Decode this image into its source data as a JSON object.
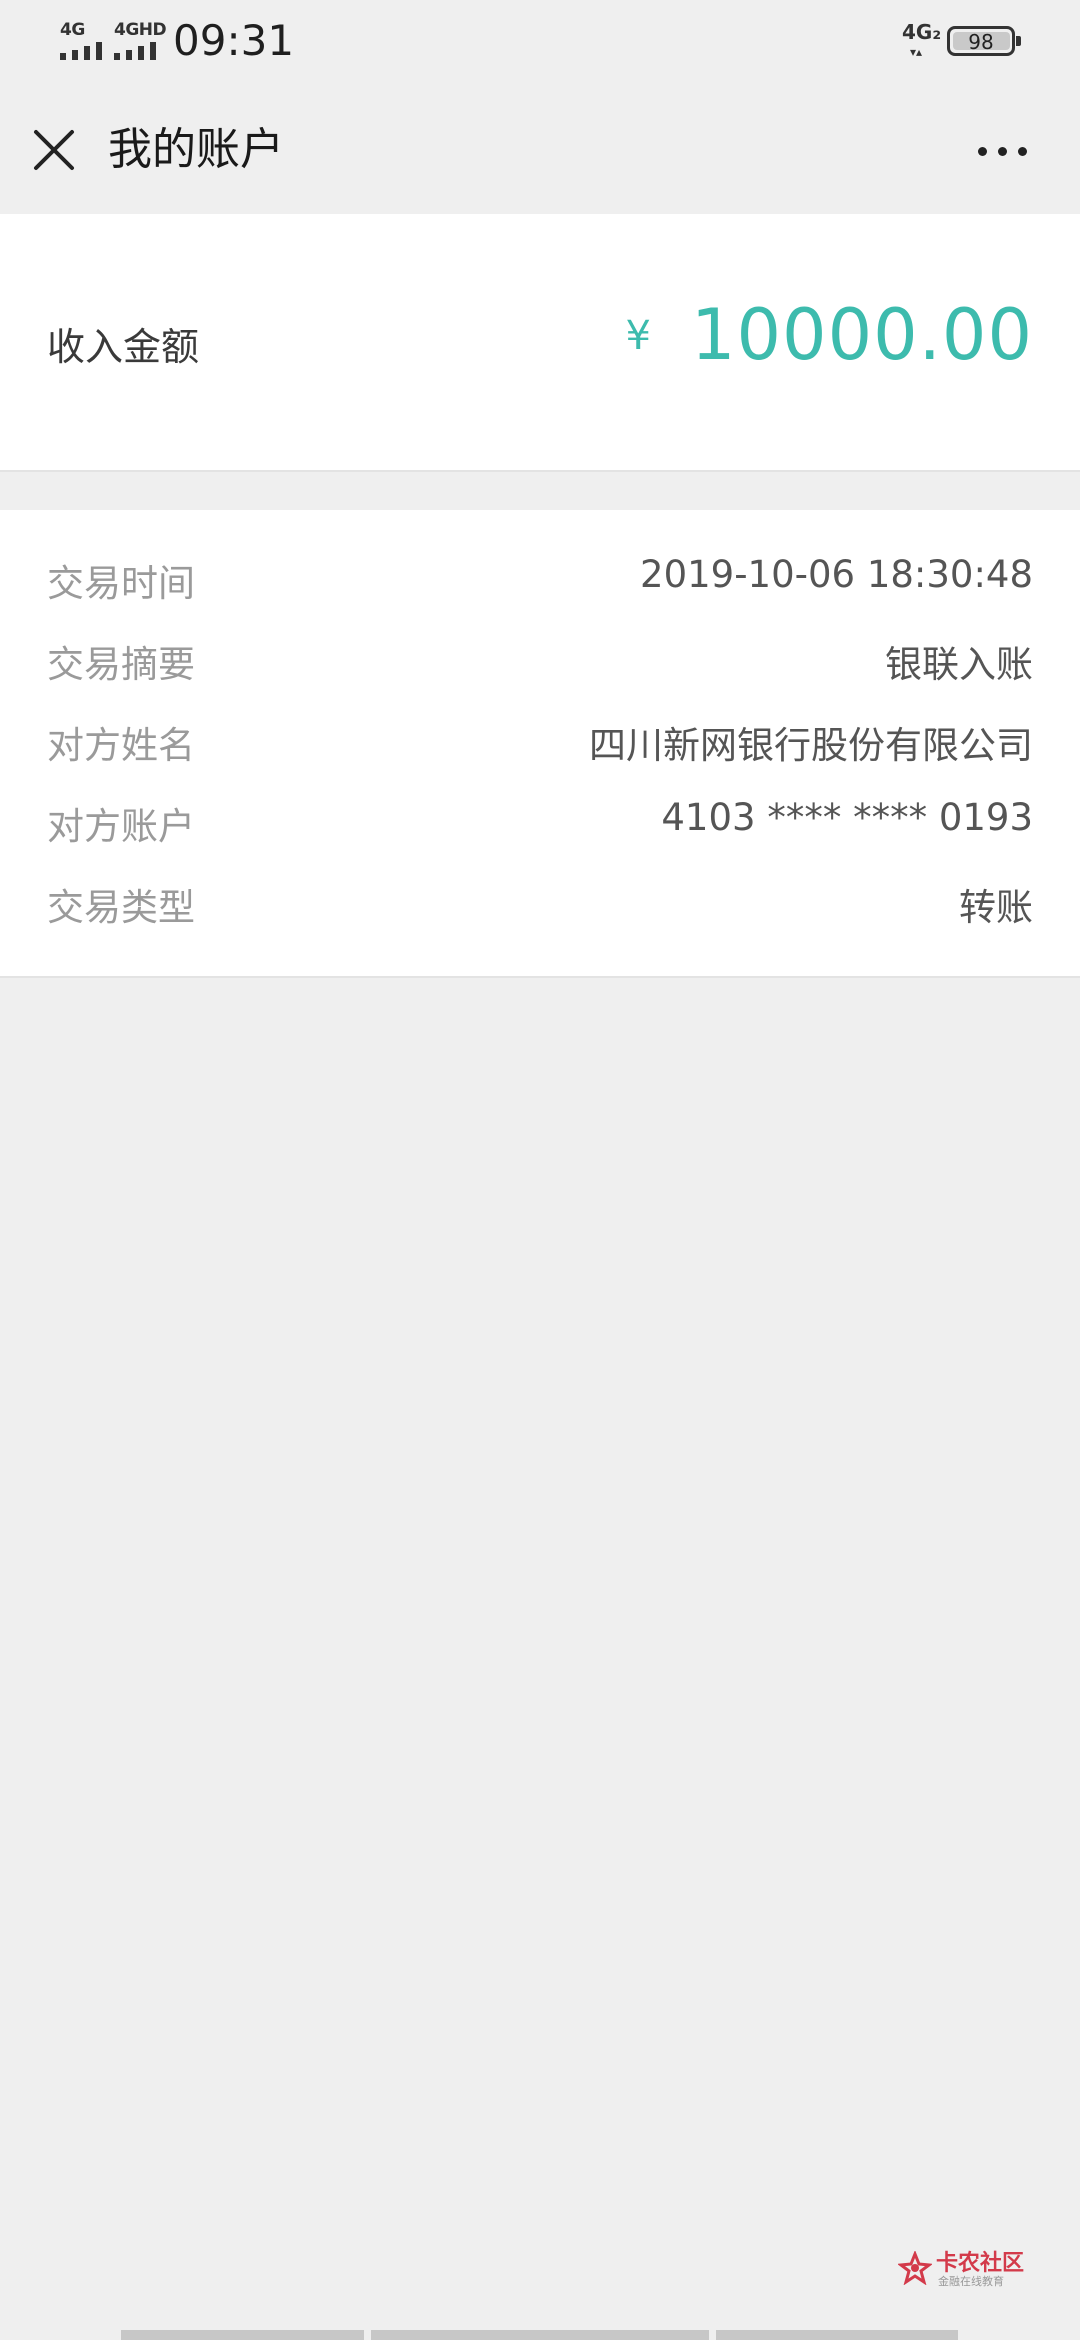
{
  "status_bar": {
    "sim1_network": "4G",
    "sim2_network": "4GHD",
    "time": "09:31",
    "right_network": "4G₂",
    "battery_level": "98"
  },
  "nav": {
    "title": "我的账户"
  },
  "amount": {
    "label": "收入金额",
    "currency_symbol": "¥",
    "value": "10000.00",
    "color": "#3dbbad"
  },
  "details": [
    {
      "label": "交易时间",
      "value": "2019-10-06 18:30:48"
    },
    {
      "label": "交易摘要",
      "value": "银联入账"
    },
    {
      "label": "对方姓名",
      "value": "四川新网银行股份有限公司"
    },
    {
      "label": "对方账户",
      "value": "4103 **** **** 0193"
    },
    {
      "label": "交易类型",
      "value": "转账"
    }
  ],
  "watermark": {
    "title": "卡农社区",
    "subtitle": "金融在线教育"
  }
}
